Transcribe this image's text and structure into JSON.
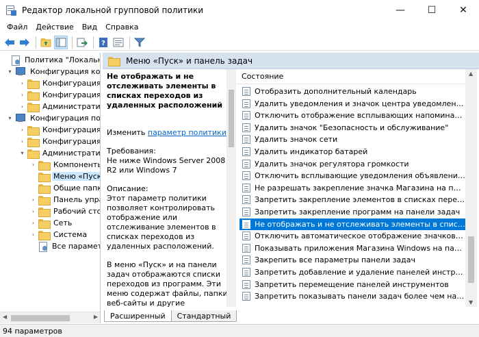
{
  "window": {
    "title": "Редактор локальной групповой политики",
    "minimize_glyph": "—",
    "maximize_glyph": "☐",
    "close_glyph": "✕"
  },
  "menu": [
    "Файл",
    "Действие",
    "Вид",
    "Справка"
  ],
  "toolbar": {
    "icons": [
      "back-arrow-icon",
      "forward-arrow-icon",
      "up-folder-icon",
      "show-hide-tree-icon",
      "export-list-icon",
      "help-icon",
      "properties-icon",
      "filter-icon"
    ]
  },
  "tree": [
    {
      "label": "Политика \"Локальный",
      "level": 0,
      "icon": "gear-page",
      "expander": ""
    },
    {
      "label": "Конфигурация комп",
      "level": 1,
      "icon": "computer",
      "expander": "▾"
    },
    {
      "label": "Конфигурация п",
      "level": 2,
      "icon": "folder",
      "expander": "›"
    },
    {
      "label": "Конфигурация W",
      "level": 2,
      "icon": "folder",
      "expander": "›"
    },
    {
      "label": "Административ",
      "level": 2,
      "icon": "folder",
      "expander": "›"
    },
    {
      "label": "Конфигурация пол",
      "level": 1,
      "icon": "computer",
      "expander": "▾"
    },
    {
      "label": "Конфигурация п",
      "level": 2,
      "icon": "folder",
      "expander": "›"
    },
    {
      "label": "Конфигурация W",
      "level": 2,
      "icon": "folder",
      "expander": "›"
    },
    {
      "label": "Административ",
      "level": 2,
      "icon": "folder",
      "expander": "▾"
    },
    {
      "label": "Компоненты",
      "level": 3,
      "icon": "folder",
      "expander": "›"
    },
    {
      "label": "Меню «Пуск",
      "level": 3,
      "icon": "folder",
      "expander": "",
      "selected": true
    },
    {
      "label": "Общие папки",
      "level": 3,
      "icon": "folder",
      "expander": ""
    },
    {
      "label": "Панель упра",
      "level": 3,
      "icon": "folder",
      "expander": "›"
    },
    {
      "label": "Рабочий стол",
      "level": 3,
      "icon": "folder",
      "expander": "›"
    },
    {
      "label": "Сеть",
      "level": 3,
      "icon": "folder",
      "expander": "›"
    },
    {
      "label": "Система",
      "level": 3,
      "icon": "folder",
      "expander": "›"
    },
    {
      "label": "Все параметры",
      "level": 3,
      "icon": "gear-page",
      "expander": ""
    }
  ],
  "pane": {
    "header": "Меню «Пуск» и панель задач"
  },
  "description": {
    "title": "Не отображать и не отслеживать элементы в списках переходов из удаленных расположений",
    "edit_prefix": "Изменить ",
    "edit_link": "параметр политики",
    "requirements_label": "Требования:",
    "requirements_text": "Не ниже Windows Server 2008 R2 или Windows 7",
    "description_label": "Описание:",
    "description_p1": "Этот параметр политики позволяет контролировать отображение или отслеживание элементов в списках переходов из удаленных расположений.",
    "description_p2": "В меню «Пуск» и на панели задач отображаются списки переходов из программ. Эти меню содержат файлы, папки, веб-сайты и другие релевантные элементы для таких программ. Это позволяет пользователям быстро получать доступ"
  },
  "list": {
    "header": "Состояние",
    "items": [
      "Отобразить дополнительный календарь",
      "Удалить уведомления и значок центра уведомлений",
      "Отключить отображение всплывающих напоминаний в ...",
      "Удалить значок \"Безопасность и обслуживание\"",
      "Удалить значок сети",
      "Удалить индикатор батарей",
      "Удалить значок регулятора громкости",
      "Отключить всплывающие уведомления объявлений ком...",
      "Не разрешать закрепление значка Магазина на панели з...",
      "Запретить закрепление элементов в списках переходов",
      "Запретить закрепление программ на панели задач",
      "Не отображать и не отслеживать элементы в списках пе...",
      "Отключить автоматическое отображение значков уведо...",
      "Показывать приложения Магазина Windows на панели з...",
      "Закрепить все параметры панели задач",
      "Запретить добавление и удаление панелей инструментов",
      "Запретить перемещение панелей инструментов",
      "Запретить показывать панели задач более чем на одном"
    ],
    "selected_index": 11
  },
  "tabs": [
    "Расширенный",
    "Стандартный"
  ],
  "active_tab": 0,
  "status": "94 параметров"
}
